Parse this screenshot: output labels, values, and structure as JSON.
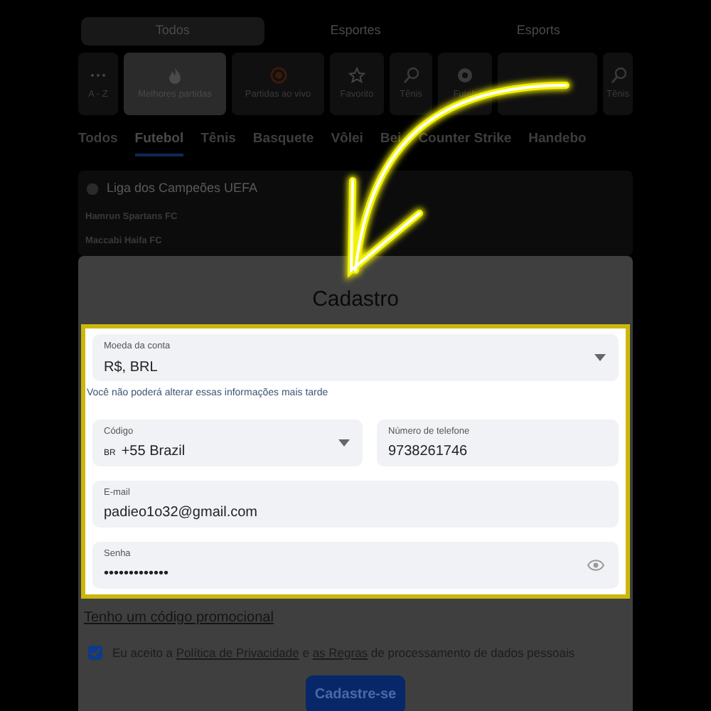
{
  "top_tabs": [
    {
      "label": "Todos",
      "selected": true
    },
    {
      "label": "Esportes",
      "selected": false
    },
    {
      "label": "Esports",
      "selected": false
    }
  ],
  "categories": [
    {
      "kind": "dots",
      "label": "A - Z",
      "selected": false
    },
    {
      "kind": "fire",
      "label": "Melhores partidas",
      "selected": true
    },
    {
      "kind": "live",
      "label": "Partidas ao vivo",
      "selected": false
    },
    {
      "kind": "star",
      "label": "Favorito",
      "selected": false
    },
    {
      "kind": "racket",
      "label": "Tênis",
      "selected": false
    },
    {
      "kind": "ball",
      "label": "Futeb",
      "selected": false
    },
    {
      "kind": "blank",
      "selected": false
    },
    {
      "kind": "racket",
      "label": "Tênis",
      "selected": false
    }
  ],
  "sport_tabs": [
    {
      "label": "Todos",
      "selected": false
    },
    {
      "label": "Futebol",
      "selected": true
    },
    {
      "label": "Tênis",
      "selected": false
    },
    {
      "label": "Basquete",
      "selected": false
    },
    {
      "label": "Vôlei",
      "selected": false
    },
    {
      "label": "Bei",
      "selected": false
    },
    {
      "label": "Counter Strike",
      "selected": false
    },
    {
      "label": "Handebo",
      "selected": false
    }
  ],
  "league": {
    "name": "Liga dos Campeões UEFA",
    "teams": [
      "Hamrun Spartans FC",
      "Maccabi Haifa FC"
    ]
  },
  "modal": {
    "title": "Cadastro",
    "currency": {
      "label": "Moeda da conta",
      "value": "R$, BRL"
    },
    "note": "Você não poderá alterar essas informações mais tarde",
    "code": {
      "label": "Código",
      "flag": "BR",
      "value": "+55 Brazil"
    },
    "phone": {
      "label": "Número de telefone",
      "value": "9738261746"
    },
    "email": {
      "label": "E-mail",
      "value": "padieo1o32@gmail.com"
    },
    "password": {
      "label": "Senha",
      "value": "•••••••••••••"
    },
    "promo_link": "Tenho um código promocional",
    "consent": {
      "checked": true,
      "segments": [
        {
          "kind": "text",
          "text": "Eu aceito a "
        },
        {
          "kind": "link",
          "text": "Política de Privacidade"
        },
        {
          "kind": "text",
          "text": " e "
        },
        {
          "kind": "link",
          "text": "as Regras"
        },
        {
          "kind": "text",
          "text": " de processamento de dados pessoais"
        }
      ]
    },
    "submit": "Cadastre-se"
  }
}
